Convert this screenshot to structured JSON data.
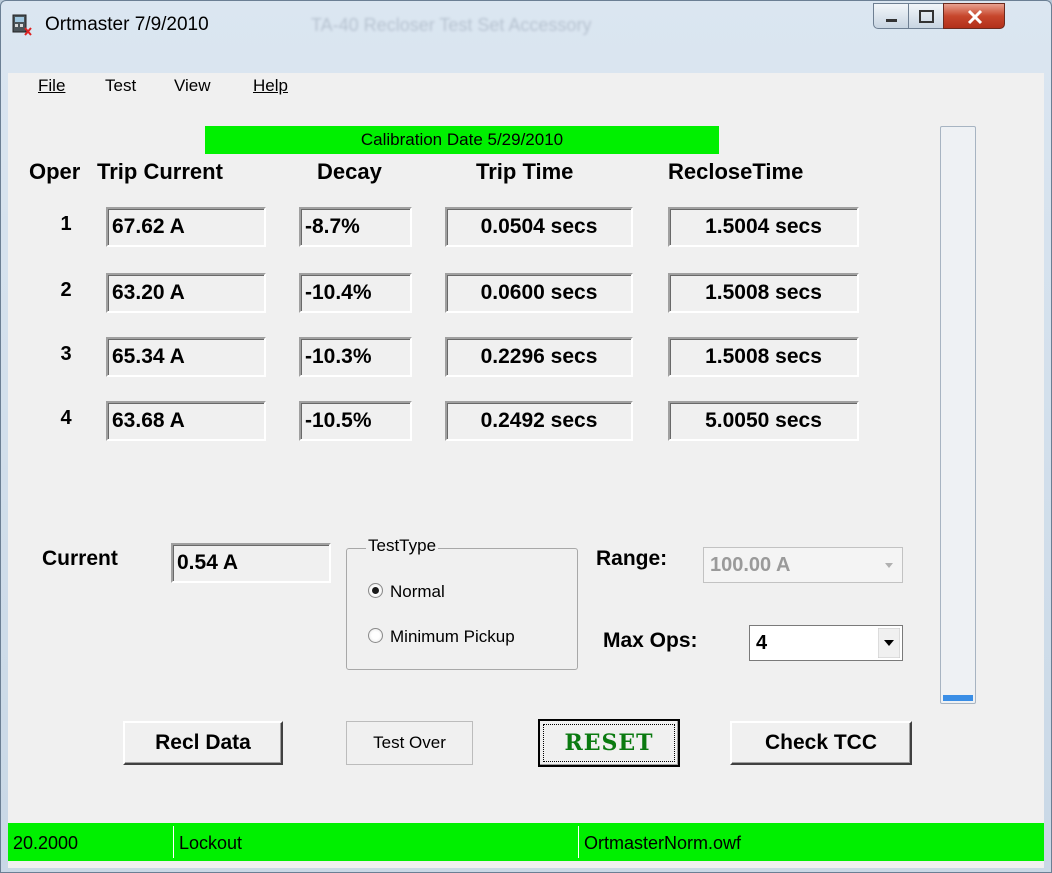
{
  "window": {
    "title": "Ortmaster 7/9/2010",
    "background_title": "TA-40 Recloser Test Set Accessory"
  },
  "menu": {
    "file": "File",
    "test": "Test",
    "view": "View",
    "help": "Help"
  },
  "calibration_label": "Calibration Date 5/29/2010",
  "headers": {
    "oper": "Oper",
    "trip_current": "Trip Current",
    "decay": "Decay",
    "trip_time": "Trip Time",
    "reclose_time": "RecloseTime"
  },
  "operations": [
    {
      "oper": "1",
      "trip_current": "67.62 A",
      "decay": "-8.7%",
      "trip_time": "0.0504 secs",
      "reclose_time": "1.5004 secs"
    },
    {
      "oper": "2",
      "trip_current": "63.20 A",
      "decay": "-10.4%",
      "trip_time": "0.0600 secs",
      "reclose_time": "1.5008 secs"
    },
    {
      "oper": "3",
      "trip_current": "65.34 A",
      "decay": "-10.3%",
      "trip_time": "0.2296 secs",
      "reclose_time": "1.5008 secs"
    },
    {
      "oper": "4",
      "trip_current": "63.68 A",
      "decay": "-10.5%",
      "trip_time": "0.2492 secs",
      "reclose_time": "5.0050 secs"
    }
  ],
  "current": {
    "label": "Current",
    "value": "0.54 A"
  },
  "test_type": {
    "title": "TestType",
    "options": [
      "Normal",
      "Minimum Pickup"
    ],
    "selected": "Normal"
  },
  "range": {
    "label": "Range:",
    "value": "100.00 A"
  },
  "max_ops": {
    "label": "Max Ops:",
    "value": "4"
  },
  "buttons": {
    "recl_data": "Recl Data",
    "test_over": "Test Over",
    "reset": "RESET",
    "check_tcc": "Check TCC"
  },
  "progress_fraction": 0.01,
  "status": {
    "value": "20.2000",
    "state": "Lockout",
    "file": "OrtmasterNorm.owf"
  },
  "colors": {
    "status_green": "#00f000",
    "reset_text": "#0a7a10",
    "progress_fill": "#3a8ee6"
  },
  "icons": [
    "app-icon",
    "minimize-icon",
    "maximize-icon",
    "close-icon",
    "chevron-down-icon"
  ]
}
